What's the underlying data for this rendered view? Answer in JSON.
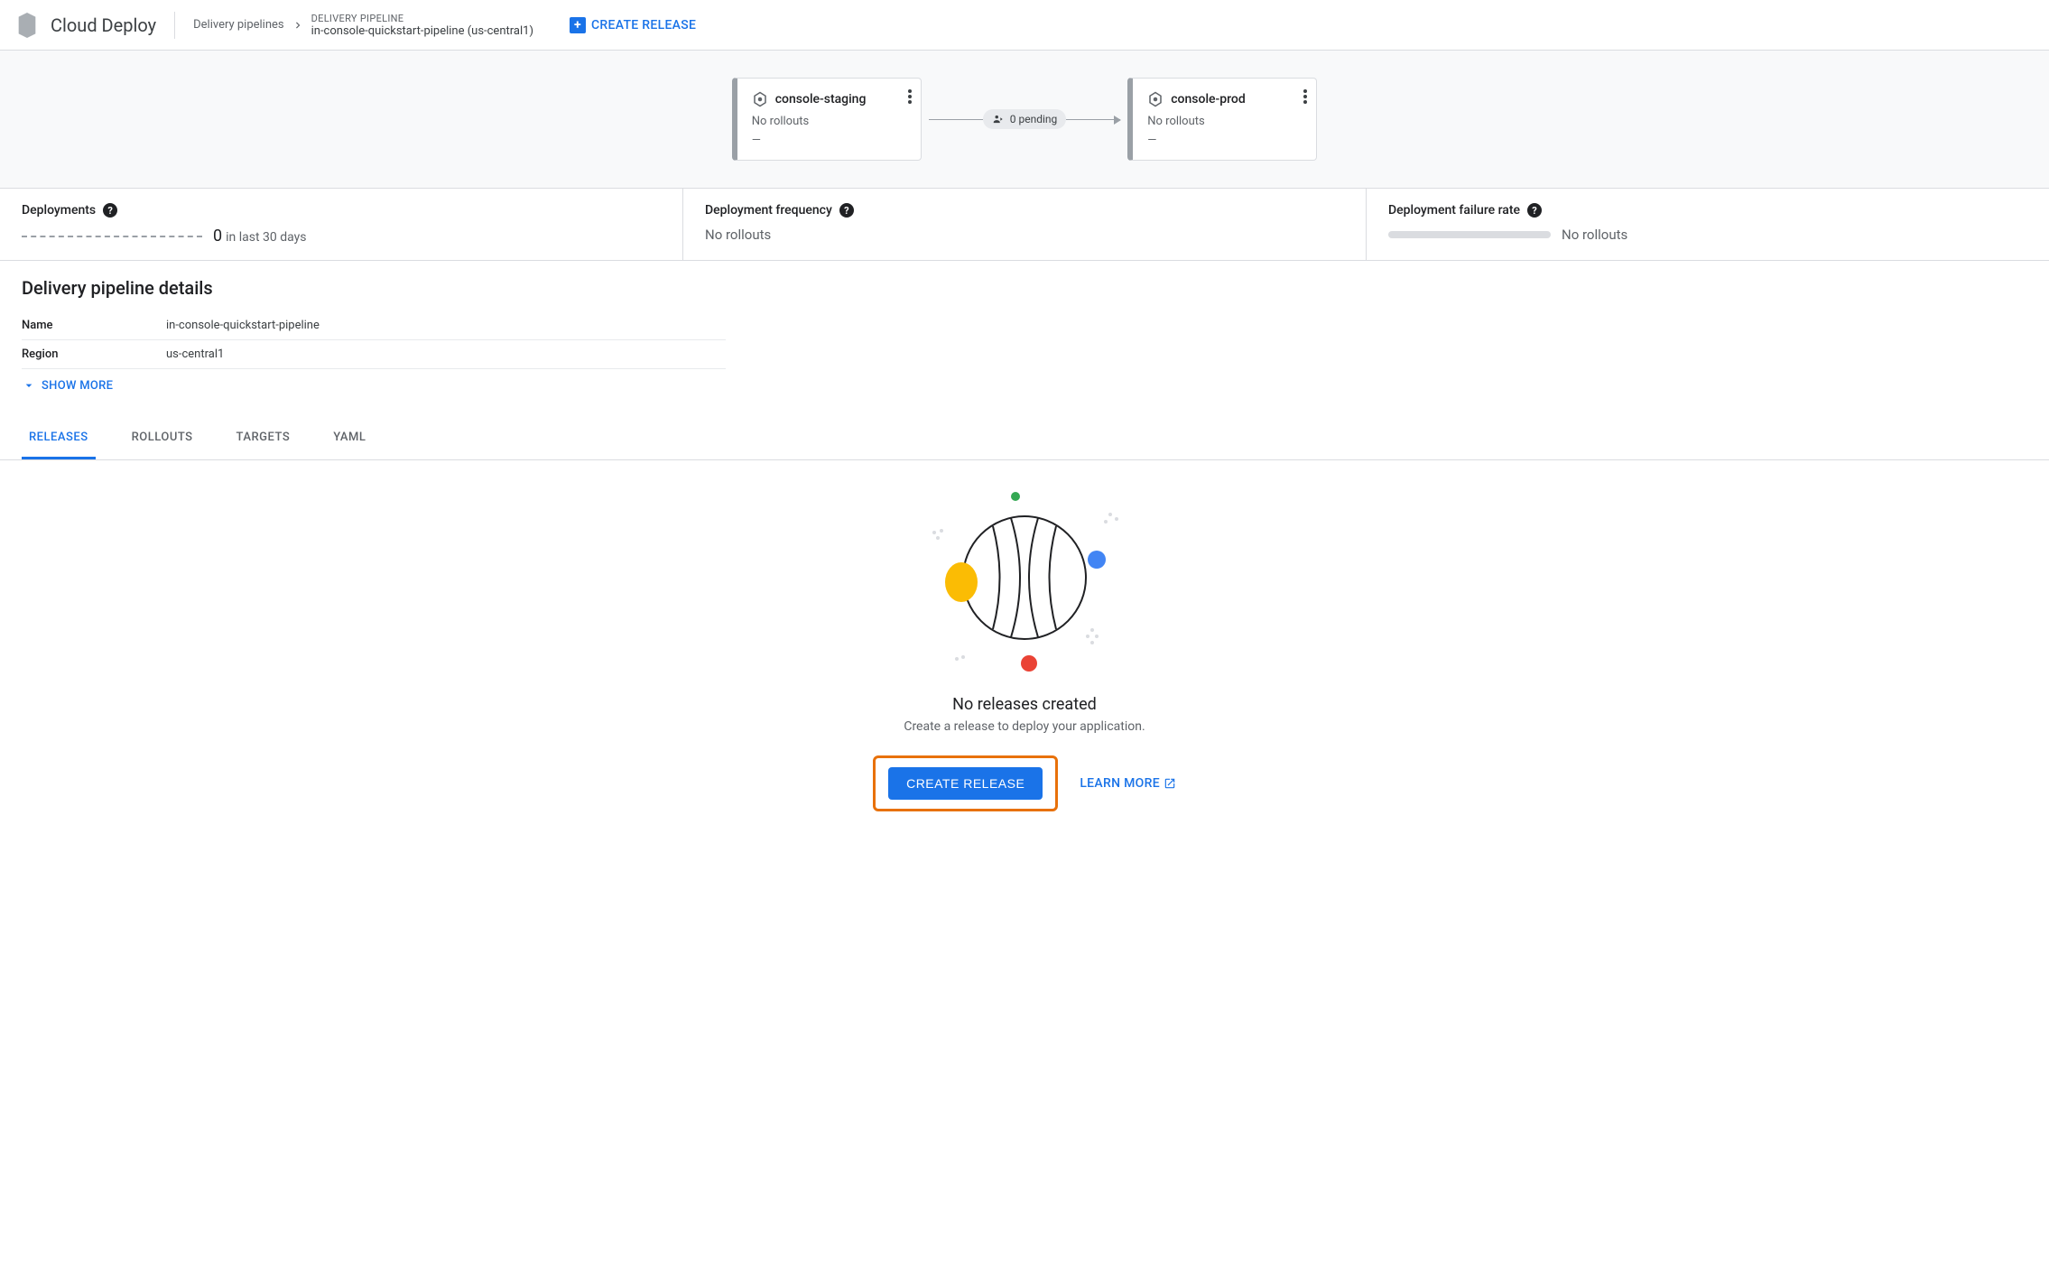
{
  "header": {
    "product": "Cloud Deploy",
    "breadcrumb_root": "Delivery pipelines",
    "breadcrumb_label": "DELIVERY PIPELINE",
    "breadcrumb_value": "in-console-quickstart-pipeline (us-central1)",
    "create_release": "CREATE RELEASE"
  },
  "pipeline": {
    "stages": [
      {
        "name": "console-staging",
        "status": "No rollouts",
        "dash": "—"
      },
      {
        "name": "console-prod",
        "status": "No rollouts",
        "dash": "—"
      }
    ],
    "connector_badge": "0 pending"
  },
  "stats": {
    "deployments": {
      "title": "Deployments",
      "count": "0",
      "suffix": "in last 30 days"
    },
    "frequency": {
      "title": "Deployment frequency",
      "value": "No rollouts"
    },
    "failure": {
      "title": "Deployment failure rate",
      "value": "No rollouts"
    }
  },
  "details": {
    "title": "Delivery pipeline details",
    "rows": [
      {
        "label": "Name",
        "value": "in-console-quickstart-pipeline"
      },
      {
        "label": "Region",
        "value": "us-central1"
      }
    ],
    "show_more": "SHOW MORE"
  },
  "tabs": [
    "RELEASES",
    "ROLLOUTS",
    "TARGETS",
    "YAML"
  ],
  "empty": {
    "title": "No releases created",
    "subtitle": "Create a release to deploy your application.",
    "primary": "CREATE RELEASE",
    "secondary": "LEARN MORE"
  }
}
